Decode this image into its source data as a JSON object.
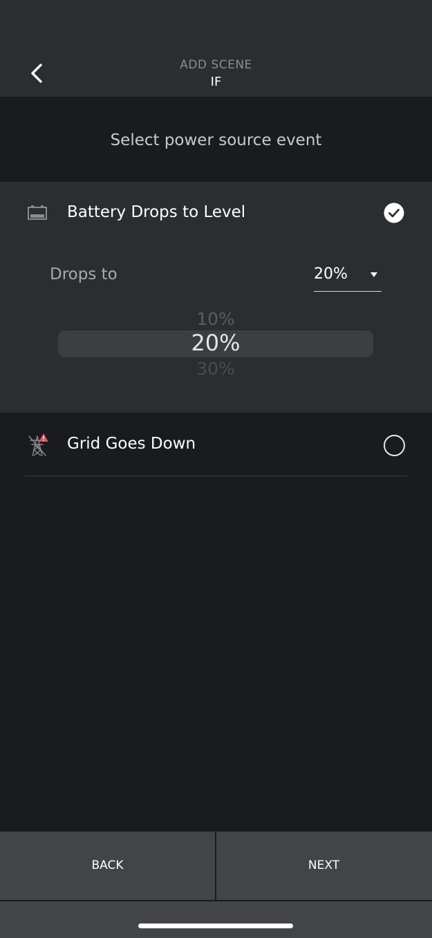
{
  "header": {
    "subtitle": "ADD SCENE",
    "title": "IF"
  },
  "prompt": "Select power source event",
  "options": [
    {
      "label": "Battery Drops to Level",
      "selected": true,
      "icon": "battery-icon"
    },
    {
      "label": "Grid Goes Down",
      "selected": false,
      "icon": "grid-down-icon"
    }
  ],
  "level": {
    "label": "Drops to",
    "selected_value": "20%",
    "picker": {
      "prev": "10%",
      "current": "20%",
      "next": "30%"
    }
  },
  "buttons": {
    "back": "BACK",
    "next": "NEXT"
  },
  "colors": {
    "background": "#1a1b1e",
    "panel": "#2c2d31",
    "button_bar": "#434448",
    "alert": "#e0535b"
  }
}
